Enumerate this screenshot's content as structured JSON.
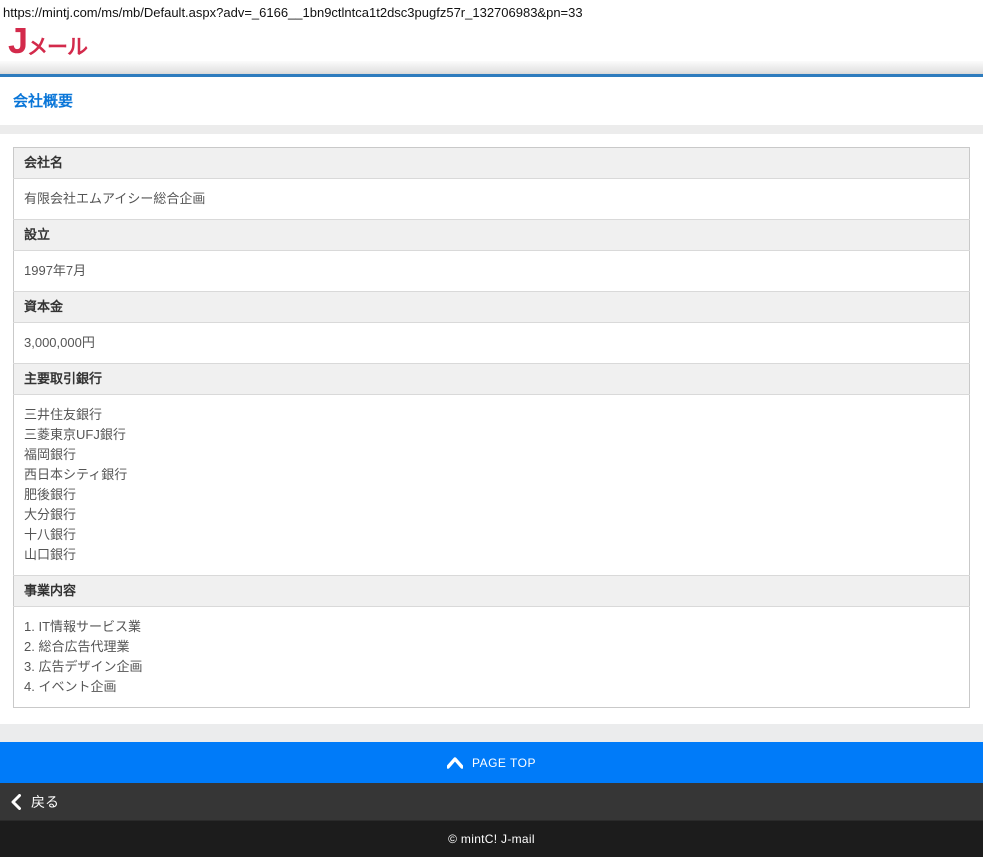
{
  "page": {
    "url_line": "https://mintj.com/ms/mb/Default.aspx?adv=_6166__1bn9ctlntca1t2dsc3pugfz57r_132706983&pn=33",
    "logo_main": "J",
    "logo_rest": "メール",
    "title": "会社概要"
  },
  "company_table": {
    "rows": [
      {
        "label": "会社名",
        "value": "有限会社エムアイシー総合企画"
      },
      {
        "label": "設立",
        "value": "1997年7月"
      },
      {
        "label": "資本金",
        "value": "3,000,000円"
      },
      {
        "label": "主要取引銀行",
        "value_lines": [
          "三井住友銀行",
          "三菱東京UFJ銀行",
          "福岡銀行",
          "西日本シティ銀行",
          "肥後銀行",
          "大分銀行",
          "十八銀行",
          "山口銀行"
        ]
      },
      {
        "label": "事業内容",
        "value_lines": [
          "1. IT情報サービス業",
          "2. 総合広告代理業",
          "3. 広告デザイン企画",
          "4. イベント企画"
        ]
      }
    ]
  },
  "footer": {
    "page_top_label": "PAGE TOP",
    "back_label": "戻る",
    "copyright": "© mintC! J-mail"
  },
  "colors": {
    "logo_red": "#d32a4b",
    "line_blue": "#2e7cbe",
    "title_blue": "#0a76d8",
    "pagetop_blue": "#007bf9",
    "back_bar_gray": "#363636",
    "footer_black": "#1c1c1c",
    "table_header_bg": "#f0f0f0",
    "table_border": "#c9c9c9"
  }
}
